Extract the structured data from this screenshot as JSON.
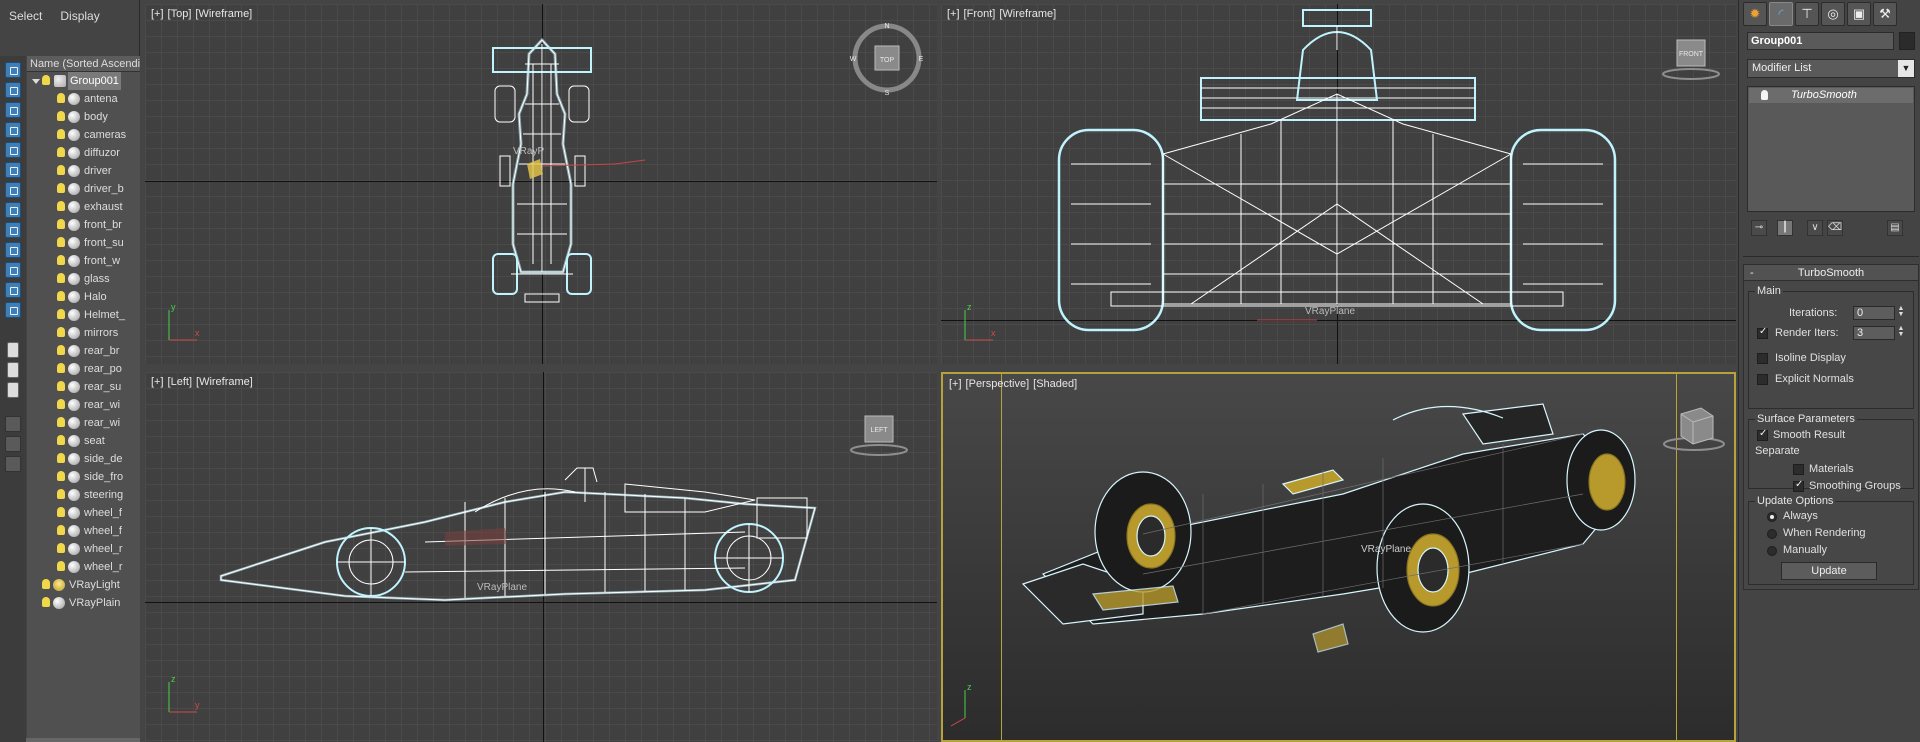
{
  "menu": {
    "select": "Select",
    "display": "Display"
  },
  "explorer": {
    "header": "Name (Sorted Ascending)",
    "root": "Group001",
    "children": [
      "antena",
      "body",
      "cameras",
      "diffuzor",
      "driver",
      "driver_b",
      "exhaust",
      "front_br",
      "front_su",
      "front_w",
      "glass",
      "Halo",
      "Helmet_",
      "mirrors",
      "rear_br",
      "rear_po",
      "rear_su",
      "rear_wi",
      "rear_wi",
      "seat",
      "side_de",
      "side_fro",
      "steering",
      "wheel_f",
      "wheel_f",
      "wheel_r",
      "wheel_r"
    ],
    "top_level": [
      "VRayLight",
      "VRayPlain"
    ]
  },
  "viewports": {
    "top": {
      "plus": "[+]",
      "view": "[Top]",
      "mode": "[Wireframe]",
      "cube": "TOP",
      "compass": [
        "N",
        "E",
        "S",
        "W"
      ],
      "overlay": "VRayP"
    },
    "front": {
      "plus": "[+]",
      "view": "[Front]",
      "mode": "[Wireframe]",
      "cube": "FRONT",
      "overlay": "VRayPlane"
    },
    "left": {
      "plus": "[+]",
      "view": "[Left]",
      "mode": "[Wireframe]",
      "cube": "LEFT",
      "overlay": "VRayPlane"
    },
    "perspective": {
      "plus": "[+]",
      "view": "[Perspective]",
      "mode": "[Shaded]",
      "overlay": "VRayPlane"
    }
  },
  "axes": {
    "x": "x",
    "y": "y",
    "z": "z"
  },
  "command_panel": {
    "object_name": "Group001",
    "modifier_list": "Modifier List",
    "stack_item": "TurboSmooth",
    "rollout_title": "TurboSmooth",
    "main": {
      "title": "Main",
      "iterations_label": "Iterations:",
      "iterations_value": "0",
      "render_iters_label": "Render Iters:",
      "render_iters_value": "3",
      "render_iters_checked": true,
      "isoline": "Isoline Display",
      "explicit_normals": "Explicit Normals"
    },
    "surface": {
      "title": "Surface Parameters",
      "smooth_result": "Smooth Result",
      "separate": "Separate",
      "materials": "Materials",
      "smoothing_groups": "Smoothing Groups"
    },
    "update_options": {
      "title": "Update Options",
      "always": "Always",
      "when_rendering": "When Rendering",
      "manually": "Manually",
      "update_button": "Update"
    }
  },
  "colors": {
    "wire_glow": "#bff4ff",
    "viewport_bg": "#404040",
    "selection_accent": "#b8a23a",
    "bulb": "#f0d84a"
  }
}
